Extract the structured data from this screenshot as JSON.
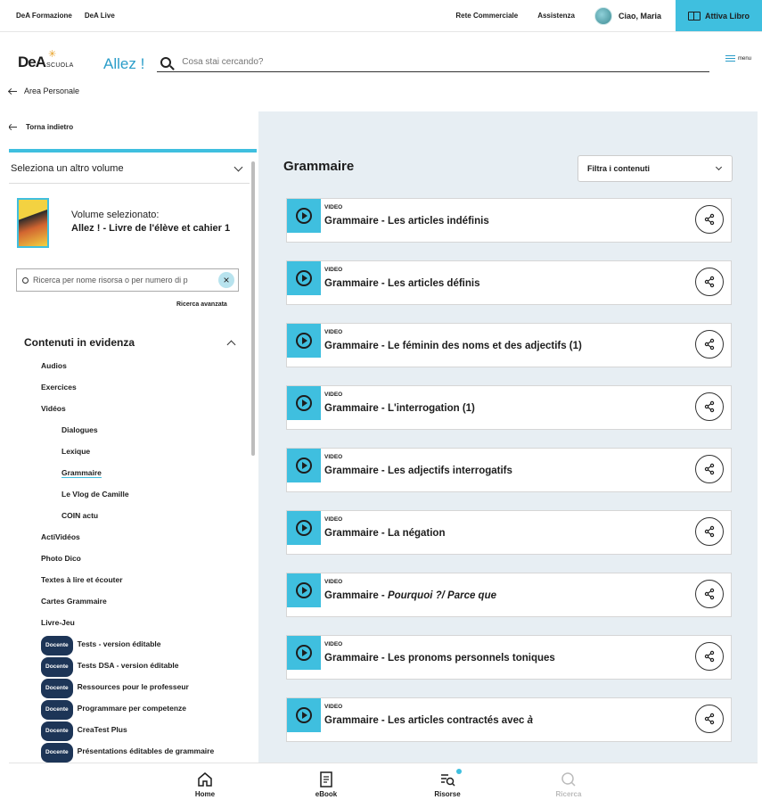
{
  "topbar": {
    "links_left": [
      "DeA Formazione",
      "DeA Live"
    ],
    "rete": "Rete Commerciale",
    "assistenza": "Assistenza",
    "user": "Ciao, Maria",
    "attiva": "Attiva Libro"
  },
  "header": {
    "logo_dea": "DeA",
    "logo_scuola": "SCUOLA",
    "product": "Allez !",
    "search_placeholder": "Cosa stai cercando?",
    "menu": "menu"
  },
  "area_personale": "Area Personale",
  "left": {
    "back": "Torna indietro",
    "select_volume": "Seleziona un altro volume",
    "volume_label": "Volume selezionato:",
    "volume_title": "Allez ! - Livre de l'élève et cahier 1",
    "search_placeholder": "Ricerca per nome risorsa o per numero di p",
    "advanced": "Ricerca avanzata",
    "featured_title": "Contenuti in evidenza",
    "nav": [
      {
        "label": "Audios",
        "sub": false
      },
      {
        "label": "Exercices",
        "sub": false
      },
      {
        "label": "Vidéos",
        "sub": false
      },
      {
        "label": "Dialogues",
        "sub": true
      },
      {
        "label": "Lexique",
        "sub": true
      },
      {
        "label": "Grammaire",
        "sub": true,
        "active": true
      },
      {
        "label": "Le Vlog de Camille",
        "sub": true
      },
      {
        "label": "COIN actu",
        "sub": true
      },
      {
        "label": "ActiVidéos",
        "sub": false
      },
      {
        "label": "Photo Dico",
        "sub": false
      },
      {
        "label": "Textes à lire et écouter",
        "sub": false
      },
      {
        "label": "Cartes Grammaire",
        "sub": false
      },
      {
        "label": "Livre-Jeu",
        "sub": false
      },
      {
        "label": "Tests - version éditable",
        "sub": false,
        "docente": true
      },
      {
        "label": "Tests DSA - version éditable",
        "sub": false,
        "docente": true
      },
      {
        "label": "Ressources pour le professeur",
        "sub": false,
        "docente": true
      },
      {
        "label": "Programmare per competenze",
        "sub": false,
        "docente": true
      },
      {
        "label": "CreaTest Plus",
        "sub": false,
        "docente": true
      },
      {
        "label": "Présentations éditables de grammaire",
        "sub": false,
        "docente": true
      }
    ],
    "docente_label": "Docente"
  },
  "main": {
    "title": "Grammaire",
    "filter": "Filtra i contenuti",
    "cards": [
      {
        "tag": "VIDEO",
        "title": "Grammaire - Les articles indéfinis",
        "italic": ""
      },
      {
        "tag": "VIDEO",
        "title": "Grammaire - Les articles définis",
        "italic": ""
      },
      {
        "tag": "VIDEO",
        "title": "Grammaire - Le féminin des noms et des adjectifs (1)",
        "italic": ""
      },
      {
        "tag": "VIDEO",
        "title": "Grammaire - L'interrogation (1)",
        "italic": ""
      },
      {
        "tag": "VIDEO",
        "title": "Grammaire - Les adjectifs interrogatifs",
        "italic": ""
      },
      {
        "tag": "VIDEO",
        "title": "Grammaire - La négation",
        "italic": ""
      },
      {
        "tag": "VIDEO",
        "title": "Grammaire - ",
        "italic": "Pourquoi ?/ Parce que"
      },
      {
        "tag": "VIDEO",
        "title": "Grammaire - Les pronoms personnels toniques",
        "italic": ""
      },
      {
        "tag": "VIDEO",
        "title": "Grammaire - Les articles contractés avec ",
        "italic": "à"
      }
    ]
  },
  "bottomnav": {
    "home": "Home",
    "ebook": "eBook",
    "risorse": "Risorse",
    "ricerca": "Ricerca"
  },
  "colors": {
    "accent": "#3fbfdf",
    "brand_blue": "#2a9dc9",
    "panel_bg": "#e7eef3",
    "docente_badge": "#1d3557"
  }
}
